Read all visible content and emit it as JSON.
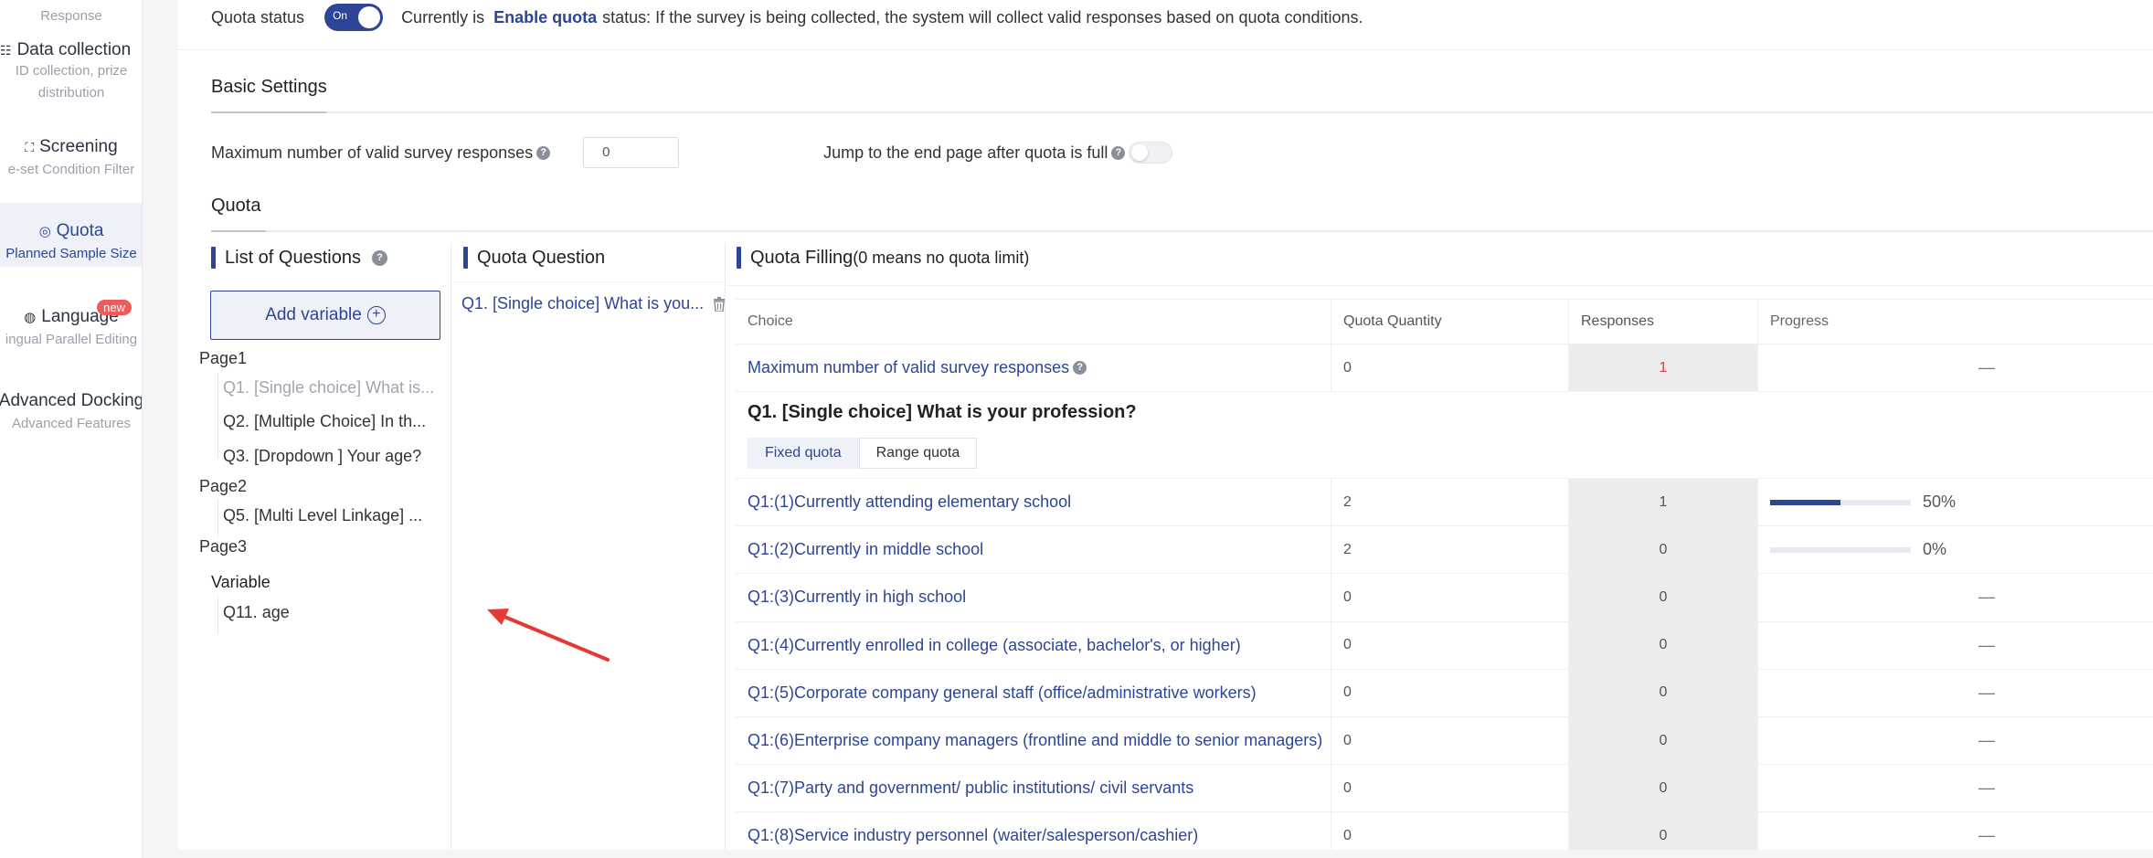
{
  "sidebar": {
    "top_label": "Response",
    "items": [
      {
        "title": "Data collection",
        "sub1": "ID collection, prize",
        "sub2": "distribution",
        "icon": "data-collection-icon"
      },
      {
        "title": "Screening",
        "sub1": "e-set Condition Filter",
        "icon": "screening-icon"
      },
      {
        "title": "Quota",
        "sub1": "Planned Sample Size",
        "icon": "quota-icon"
      },
      {
        "title": "Language",
        "sub1": "ingual Parallel Editing",
        "badge": "new",
        "icon": "globe-icon"
      },
      {
        "title": "Advanced Docking",
        "sub1": "Advanced Features"
      }
    ]
  },
  "status": {
    "label": "Quota status",
    "toggle": "On",
    "prefix": "Currently is",
    "strong": "Enable quota",
    "suffix": "status: If the survey is being collected, the system will collect valid responses based on quota conditions."
  },
  "basic": {
    "title": "Basic Settings",
    "max_label": "Maximum number of valid survey responses",
    "max_value": "0",
    "jump_label": "Jump to the end page after quota is full"
  },
  "quota": {
    "title": "Quota",
    "list_title": "List of Questions",
    "add_variable": "Add variable",
    "pages": [
      {
        "name": "Page1",
        "questions": [
          "Q1. [Single choice] What is...",
          "Q2. [Multiple Choice] In th...",
          "Q3. [Dropdown ] Your age?"
        ]
      },
      {
        "name": "Page2",
        "questions": [
          "Q5. [Multi Level Linkage] ..."
        ]
      },
      {
        "name": "Page3",
        "questions": []
      }
    ],
    "variable_title": "Variable",
    "variables": [
      "Q11. age"
    ],
    "question_col_title": "Quota Question",
    "selected_question": "Q1. [Single choice] What is you...",
    "filling_title": "Quota Filling",
    "filling_note": "(0 means no quota limit)"
  },
  "table": {
    "headers": {
      "choice": "Choice",
      "qty": "Quota Quantity",
      "resp": "Responses",
      "progress": "Progress"
    },
    "max_row": {
      "choice": "Maximum number of valid survey responses",
      "qty": "0",
      "resp": "1",
      "progress": "—"
    },
    "question_title": "Q1. [Single choice] What is your profession?",
    "tabs": [
      "Fixed quota",
      "Range quota"
    ],
    "rows": [
      {
        "choice": "Q1:(1)Currently attending elementary school",
        "qty": "2",
        "resp": "1",
        "pct": "50%",
        "fill": 0.5
      },
      {
        "choice": "Q1:(2)Currently in middle school",
        "qty": "2",
        "resp": "0",
        "pct": "0%",
        "fill": 0
      },
      {
        "choice": "Q1:(3)Currently in high school",
        "qty": "0",
        "resp": "0",
        "dash": "—"
      },
      {
        "choice": "Q1:(4)Currently enrolled in college (associate, bachelor's, or higher)",
        "qty": "0",
        "resp": "0",
        "dash": "—"
      },
      {
        "choice": "Q1:(5)Corporate company general staff (office/administrative workers)",
        "qty": "0",
        "resp": "0",
        "dash": "—"
      },
      {
        "choice": "Q1:(6)Enterprise company managers (frontline and middle to senior managers)",
        "qty": "0",
        "resp": "0",
        "dash": "—"
      },
      {
        "choice": "Q1:(7)Party and government/ public institutions/ civil servants",
        "qty": "0",
        "resp": "0",
        "dash": "—"
      },
      {
        "choice": "Q1:(8)Service industry personnel (waiter/salesperson/cashier)",
        "qty": "0",
        "resp": "0",
        "dash": "—"
      }
    ]
  },
  "colors": {
    "accent": "#2d4596",
    "red": "#e03b3b",
    "arrow": "#e53935"
  }
}
